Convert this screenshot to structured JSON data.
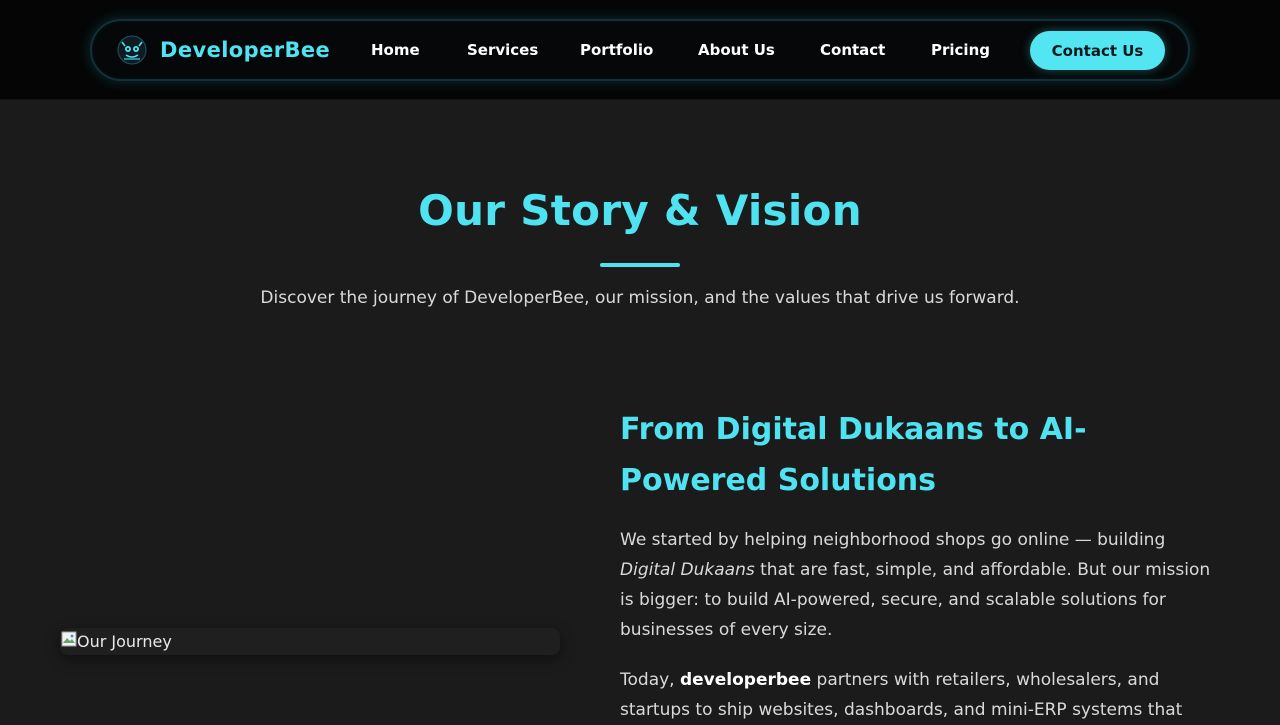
{
  "nav": {
    "brand_name": "DeveloperBee",
    "links": [
      "Home",
      "Services",
      "Portfolio",
      "About Us",
      "Contact",
      "Pricing"
    ],
    "cta_label": "Contact Us"
  },
  "hero": {
    "title": "Our Story & Vision",
    "subtitle": "Discover the journey of DeveloperBee, our mission, and the values that drive us forward."
  },
  "story": {
    "image_alt": "Our Journey",
    "heading": "From Digital Dukaans to AI-Powered Solutions",
    "p1_before": "We started by helping neighborhood shops go online — building ",
    "p1_em": "Digital Dukaans",
    "p1_after": " that are fast, simple, and affordable. But our mission is bigger: to build AI-powered, secure, and scalable solutions for businesses of every size.",
    "p2_before": "Today, ",
    "p2_strong": "developerbee",
    "p2_after": " partners with retailers, wholesalers, and startups to ship websites, dashboards, and mini-ERP systems that"
  },
  "colors": {
    "accent": "#4fe3f2",
    "background": "#1b1b1b",
    "topbar": "#050505",
    "cta_bg": "#53e6f2"
  },
  "icons": {
    "brand_logo": "bee-logo-icon",
    "image_placeholder": "broken-image-icon"
  }
}
